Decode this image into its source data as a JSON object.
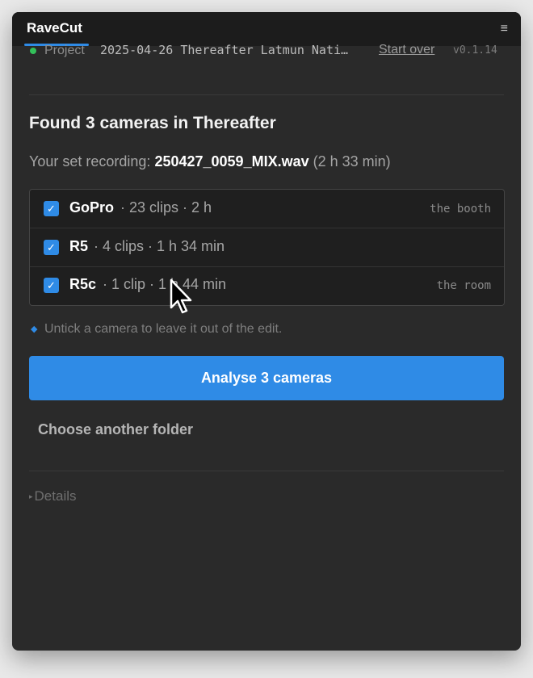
{
  "app": {
    "title": "RaveCut",
    "menu_glyph": "≡"
  },
  "project": {
    "label": "Project",
    "name": "2025-04-26 Thereafter Latmun Nati…",
    "start_over": "Start over",
    "version": "v0.1.14",
    "status_color": "#33c05a"
  },
  "main": {
    "heading": "Found 3 cameras in Thereafter",
    "recording_prefix": "Your set recording:",
    "recording_file": "250427_0059_MIX.wav",
    "recording_duration": "(2 h 33 min)"
  },
  "cameras": [
    {
      "name": "GoPro",
      "meta": "· 23 clips · 2 h",
      "tag": "the booth",
      "checked": true
    },
    {
      "name": "R5",
      "meta": "· 4 clips · 1 h 34 min",
      "tag": "",
      "checked": true
    },
    {
      "name": "R5c",
      "meta": "· 1 clip · 1 h 44 min",
      "tag": "the room",
      "checked": true
    }
  ],
  "hint": {
    "icon": "diamond-icon",
    "text": "Untick a camera to leave it out of the edit."
  },
  "actions": {
    "analyse_label": "Analyse 3 cameras",
    "choose_folder_label": "Choose another folder",
    "details_label": "Details",
    "details_icon": "caret-right-icon"
  },
  "colors": {
    "accent": "#2f8be6",
    "background": "#2a2a2a",
    "titlebar": "#1c1c1c"
  }
}
